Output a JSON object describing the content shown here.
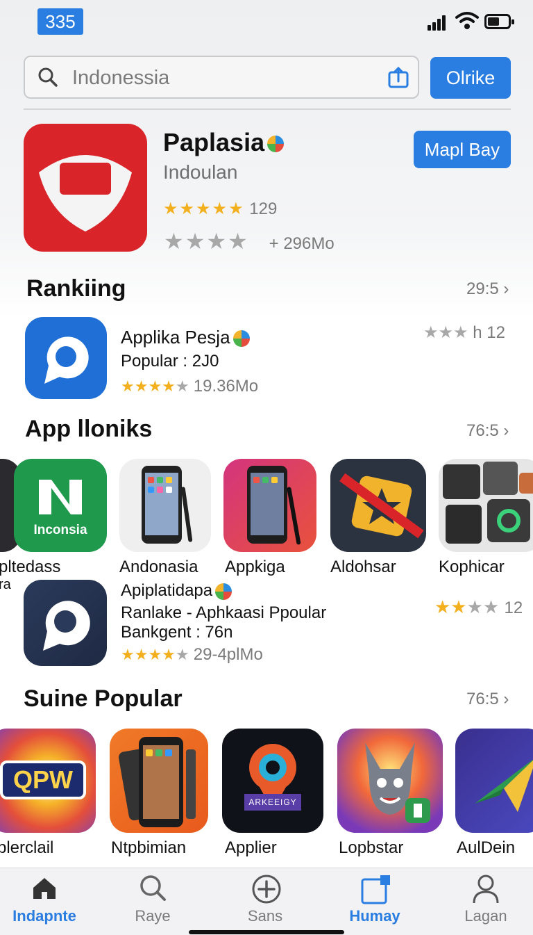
{
  "status": {
    "time": "335"
  },
  "search": {
    "placeholder": "Indonessia",
    "button_label": "Olrike"
  },
  "featured": {
    "title": "Paplasia",
    "subtitle": "Indoulan",
    "rating_count": "129",
    "size": "296Mo",
    "button_label": "Mapl Bay",
    "rating": 5
  },
  "ranking": {
    "title": "Rankiing",
    "count": "29:5",
    "item": {
      "name": "Applika Pesja",
      "line": "Popular : 2J0",
      "size": "19.36Mo",
      "side_rating": "h 12",
      "rating": 4
    }
  },
  "app_icons_section": {
    "title": "App lloniks",
    "count": "76:5",
    "apps": [
      {
        "label": "pltedass",
        "second_label": "ra"
      },
      {
        "label": "Andonasia"
      },
      {
        "label": "Appkiga"
      },
      {
        "label": "Aldohsar"
      },
      {
        "label": "Kophicar"
      }
    ],
    "green_icon_text": "Inconsia",
    "item": {
      "name": "Apiplatidapa",
      "line1": "Ranlake - Aphkaasi Ppoular",
      "line2": "Bankgent : 76n",
      "size": "29-4plMo",
      "side_rating": "12",
      "rating": 4
    }
  },
  "suine_popular": {
    "title": "Suine Popular",
    "count": "76:5",
    "apps": [
      {
        "label": "plerclail",
        "icon_text": "QPW"
      },
      {
        "label": "Ntpbimian"
      },
      {
        "label": "Applier",
        "icon_text": "ARKEEIGY"
      },
      {
        "label": "Lopbstar"
      },
      {
        "label": "AulDein"
      }
    ]
  },
  "tabbar": {
    "tabs": [
      {
        "label": "Indapnte",
        "icon": "home-icon",
        "active": true
      },
      {
        "label": "Raye",
        "icon": "search-icon",
        "active": false
      },
      {
        "label": "Sans",
        "icon": "plus-circle-icon",
        "active": false
      },
      {
        "label": "Humay",
        "icon": "square-icon",
        "active": true
      },
      {
        "label": "Lagan",
        "icon": "person-icon",
        "active": false
      }
    ]
  },
  "colors": {
    "accent": "#2a7de1",
    "featured_red": "#d9242a",
    "star_gold": "#f2b01e"
  }
}
